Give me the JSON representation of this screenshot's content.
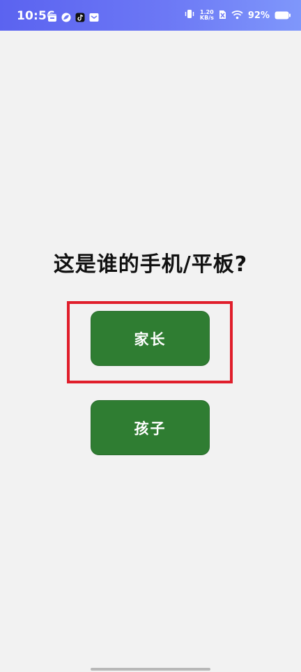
{
  "status_bar": {
    "time": "10:56",
    "net_speed_value": "1.20",
    "net_speed_unit": "KB/s",
    "battery": "92%",
    "icons": [
      "calendar-icon",
      "leaf-app-icon",
      "tiktok-icon",
      "mail-icon",
      "vibrate-icon",
      "no-sim-icon",
      "wifi-icon",
      "battery-icon"
    ]
  },
  "main": {
    "question": "这是谁的手机/平板?",
    "parent_label": "家长",
    "child_label": "孩子"
  },
  "colors": {
    "button": "#2f7d32",
    "highlight": "#e01e2b",
    "background": "#f2f2f2",
    "status_bar": "#6c78f5"
  }
}
